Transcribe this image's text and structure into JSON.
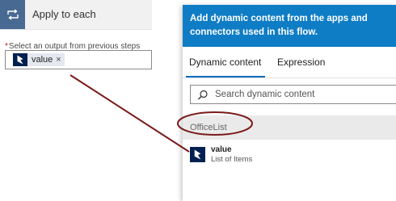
{
  "apply_card": {
    "title": "Apply to each",
    "field_required_mark": "*",
    "field_label": "Select an output from previous steps",
    "token": {
      "label": "value",
      "remove_glyph": "×",
      "icon": "dynamics-365-icon"
    }
  },
  "panel": {
    "header_text": "Add dynamic content from the apps and connectors used in this flow.",
    "tabs": [
      {
        "label": "Dynamic content",
        "active": true
      },
      {
        "label": "Expression",
        "active": false
      }
    ],
    "search": {
      "placeholder": "Search dynamic content",
      "value": ""
    },
    "group": {
      "title": "OfficeList",
      "items": [
        {
          "name": "value",
          "description": "List of Items",
          "icon": "dynamics-365-icon"
        }
      ]
    }
  },
  "colors": {
    "loop_icon_bg": "#486991",
    "panel_header_bg": "#0f7dc5",
    "tab_accent": "#0f6cbd",
    "connector_icon_bg": "#002050",
    "token_bg": "#e5e9ef",
    "annotation": "#7a1a1a"
  }
}
